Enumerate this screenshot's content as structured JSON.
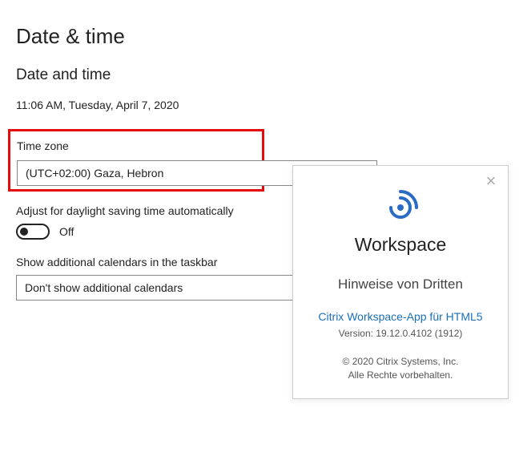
{
  "header": {
    "title": "Date & time",
    "subtitle": "Date and time"
  },
  "datetime": {
    "current": "11:06 AM, Tuesday, April 7, 2020"
  },
  "timezone": {
    "label": "Time zone",
    "value": "(UTC+02:00) Gaza, Hebron"
  },
  "dst": {
    "label": "Adjust for daylight saving time automatically",
    "state": "Off"
  },
  "calendars": {
    "label": "Show additional calendars in the taskbar",
    "value": "Don't show additional calendars"
  },
  "popup": {
    "brand": "Workspace",
    "subtitle": "Hinweise von Dritten",
    "link": "Citrix Workspace-App für HTML5",
    "version": "Version: 19.12.0.4102 (1912)",
    "copyright1": "© 2020 Citrix Systems, Inc.",
    "copyright2": "Alle Rechte vorbehalten."
  }
}
